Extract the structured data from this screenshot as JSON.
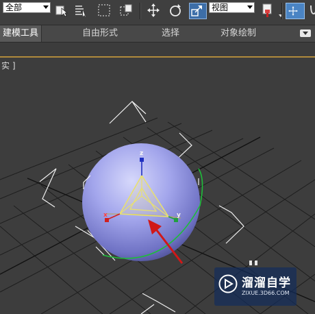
{
  "toolbar": {
    "selection_filter": "全部",
    "reference_coord": "视图"
  },
  "ribbon": {
    "tabs": [
      {
        "label": "建模工具"
      },
      {
        "label": "自由形式"
      },
      {
        "label": "选择"
      },
      {
        "label": "对象绘制"
      }
    ]
  },
  "viewport": {
    "label": "实 ]",
    "object": "sphere",
    "gizmo_axes": {
      "x": "x",
      "y": "y",
      "z": "z"
    }
  },
  "colors": {
    "sphere": "#9fa2e8",
    "grid": "#1e1e1e",
    "gizmo": "#e8e070",
    "x_axis": "#d02020",
    "y_axis": "#20a040",
    "z_axis": "#2030c0",
    "pointer_arrow": "#d01818"
  },
  "watermark": {
    "title": "溜溜自学",
    "url": "ZIXUE.3D66.COM"
  }
}
